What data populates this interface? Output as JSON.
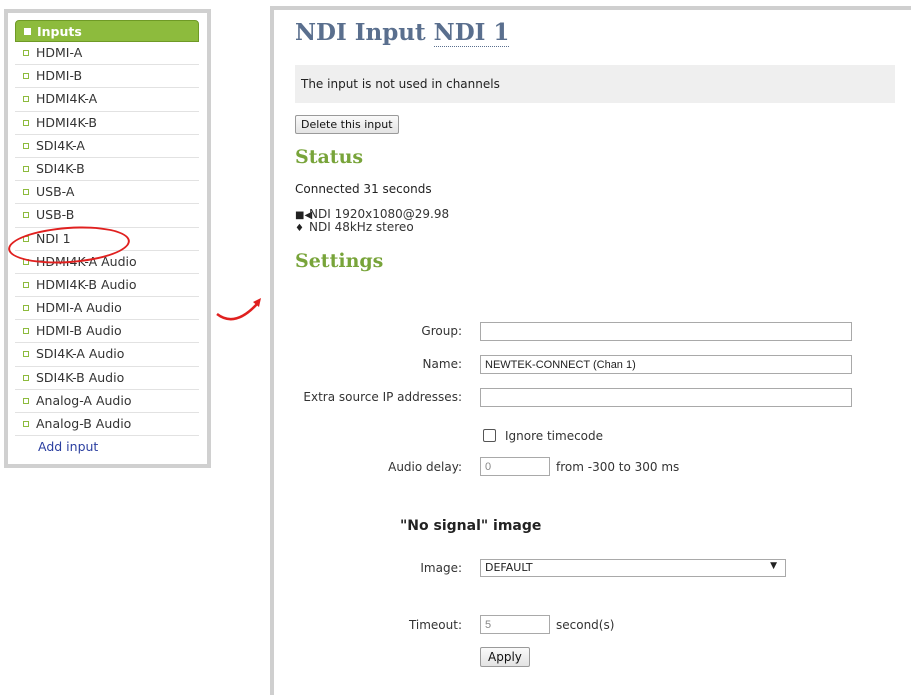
{
  "sidebar": {
    "header": "Inputs",
    "items": [
      {
        "label": "HDMI-A"
      },
      {
        "label": "HDMI-B"
      },
      {
        "label": "HDMI4K-A"
      },
      {
        "label": "HDMI4K-B"
      },
      {
        "label": "SDI4K-A"
      },
      {
        "label": "SDI4K-B"
      },
      {
        "label": "USB-A"
      },
      {
        "label": "USB-B"
      },
      {
        "label": "NDI 1"
      },
      {
        "label": "HDMI4K-A Audio"
      },
      {
        "label": "HDMI4K-B Audio"
      },
      {
        "label": "HDMI-A Audio"
      },
      {
        "label": "HDMI-B Audio"
      },
      {
        "label": "SDI4K-A Audio"
      },
      {
        "label": "SDI4K-B Audio"
      },
      {
        "label": "Analog-A Audio"
      },
      {
        "label": "Analog-B Audio"
      }
    ],
    "add_input": "Add input"
  },
  "annotation": {
    "highlight_color": "#e0201f"
  },
  "main": {
    "title_prefix": "NDI Input",
    "title_link": "NDI 1",
    "notice": "The input is not used in channels",
    "delete_button": "Delete this input",
    "status": {
      "title": "Status",
      "connected": "Connected 31 seconds",
      "video": {
        "icon": "video-camera-icon",
        "text": "NDI 1920x1080@29.98"
      },
      "audio": {
        "icon": "microphone-icon",
        "text": "NDI 48kHz stereo"
      }
    },
    "settings": {
      "title": "Settings",
      "group_label": "Group:",
      "group_value": "",
      "name_label": "Name:",
      "name_value": "NEWTEK-CONNECT (Chan 1)",
      "extra_ip_label": "Extra source IP addresses:",
      "extra_ip_value": "",
      "ignore_timecode_label": "Ignore timecode",
      "ignore_timecode_checked": false,
      "audio_delay_label": "Audio delay:",
      "audio_delay_value": "0",
      "audio_delay_hint": "from -300 to 300 ms",
      "no_signal_heading": "\"No signal\" image",
      "image_label": "Image:",
      "image_value": "DEFAULT",
      "timeout_label": "Timeout:",
      "timeout_value": "5",
      "timeout_unit": "second(s)",
      "apply_button": "Apply"
    }
  },
  "colors": {
    "accent_green": "#8dbb3d",
    "title_blue": "#5a6f8e",
    "link_blue": "#2b3fa0"
  }
}
